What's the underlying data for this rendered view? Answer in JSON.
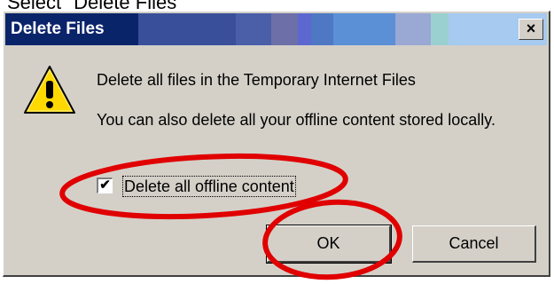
{
  "caption": "Select \"Delete Files\"",
  "dialog": {
    "title": "Delete Files",
    "close_label": "×",
    "message_primary": "Delete all files in the Temporary Internet Files",
    "message_secondary": "You can also delete all your offline content stored locally.",
    "checkbox": {
      "label": "Delete all offline content",
      "checked": true,
      "mark": "✔"
    },
    "buttons": {
      "ok": "OK",
      "cancel": "Cancel"
    }
  },
  "colors": {
    "dialog_face": "#d4d0c8",
    "title_dark": "#0a246a",
    "annotation_red": "#e00000"
  },
  "icons": {
    "warning": "warning-icon"
  }
}
